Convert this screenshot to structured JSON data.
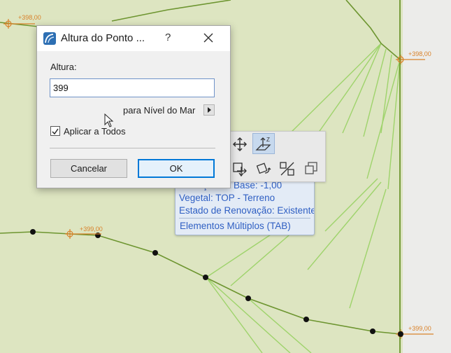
{
  "dialog": {
    "title": "Altura do Ponto ...",
    "help_label": "?",
    "height_label": "Altura:",
    "height_value": "399",
    "reference_label": "para Nível do Mar",
    "apply_all_label": "Aplicar a Todos",
    "apply_all_checked": true,
    "cancel_label": "Cancelar",
    "ok_label": "OK"
  },
  "info_tag": {
    "line1": "Elevação da Base: -1,00",
    "line2": "Vegetal: TOP - Terreno",
    "line3": "Estado de Renovação: Existente",
    "line4": "Elementos Múltiplos (TAB)"
  },
  "elevation_markers": [
    "+398,00",
    "+398,00",
    "+399,00",
    "+399,00"
  ],
  "pet_palette": {
    "icons": [
      "move-icon",
      "elevation-icon",
      "drag-copy-icon",
      "rotate-icon",
      "offset-icon",
      "multiply-icon"
    ]
  },
  "colors": {
    "canvas_bg": "#dde5c1",
    "line_dark": "#6d9530",
    "line_light": "#9ed36b",
    "marker_orange": "#d9822b",
    "tag_text": "#2f5fc3"
  }
}
